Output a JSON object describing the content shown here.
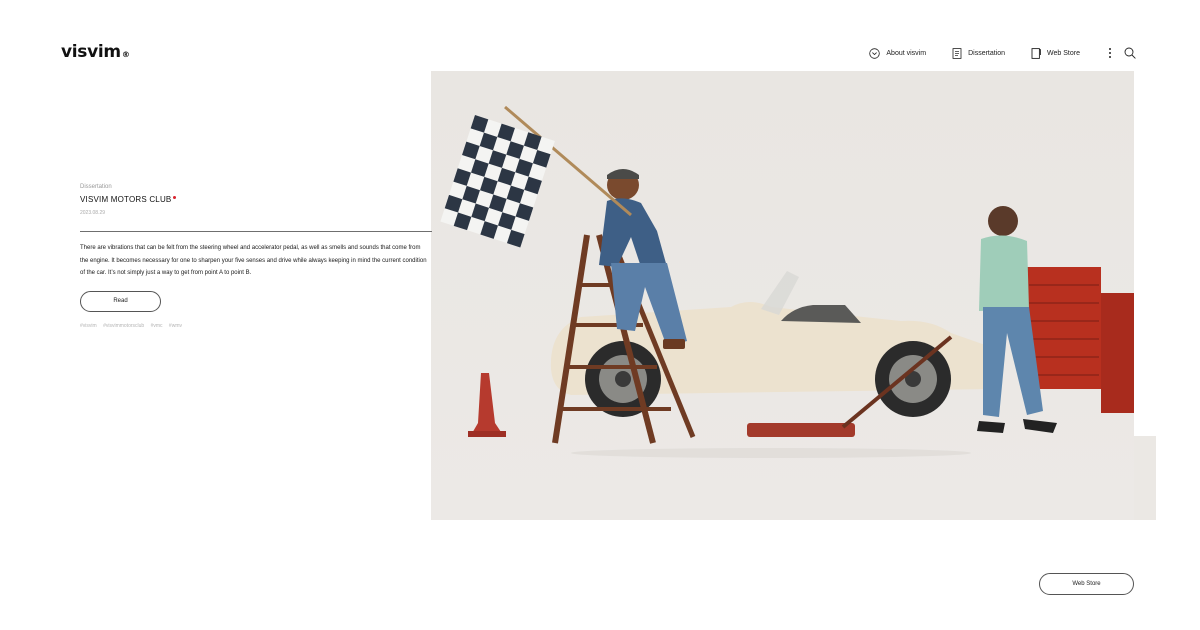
{
  "brand": {
    "name": "visvim",
    "mark": "®"
  },
  "nav": {
    "items": [
      {
        "label": "About visvim",
        "icon": "chevron-down-circle-icon"
      },
      {
        "label": "Dissertation",
        "icon": "document-icon"
      },
      {
        "label": "Web Store",
        "icon": "bookmark-icon"
      }
    ],
    "more_icon": "kebab-menu-icon",
    "search_icon": "search-icon"
  },
  "article": {
    "category": "Dissertation",
    "title": "VISVIM MOTORS CLUB",
    "date": "2023.08.29",
    "excerpt": "There are vibrations that can be felt from the steering wheel and accelerator pedal, as well as smells and sounds that come from the engine. It becomes necessary for one to sharpen your five senses and drive while always keeping in mind the current condition of the car. It’s not simply just a way to get from point A to point B.",
    "read_label": "Read",
    "tags": [
      "#visvim",
      "#visvimmotorsclub",
      "#vmc",
      "#wmv"
    ]
  },
  "footer": {
    "store_button": "Web Store"
  },
  "colors": {
    "accent_dot": "#d9232e",
    "backdrop": "#ebe8e4"
  }
}
